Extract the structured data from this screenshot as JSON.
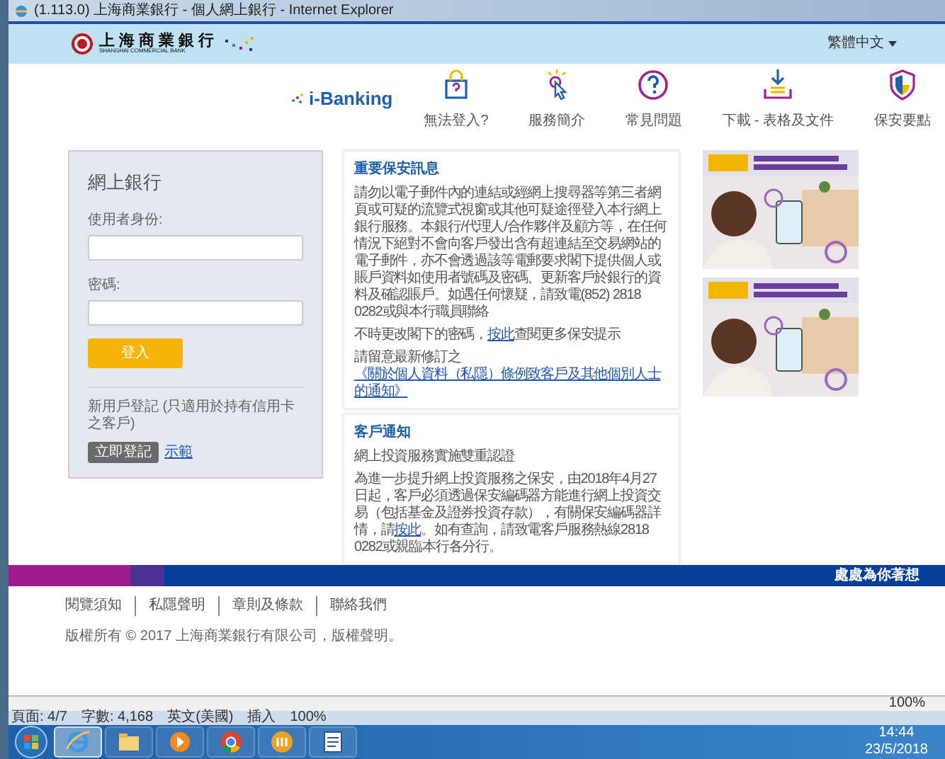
{
  "window": {
    "title": "(1.113.0) 上海商業銀行 - 個人網上銀行 - Internet Explorer"
  },
  "header": {
    "logo_cn": "上海商業銀行",
    "logo_en": "SHANGHAI COMMERCIAL BANK",
    "language": "繁體中文"
  },
  "brand": "i-Banking",
  "quick_links": [
    {
      "kind": "lock",
      "label": "無法登入?"
    },
    {
      "kind": "pointer",
      "label": "服務簡介"
    },
    {
      "kind": "question",
      "label": "常見問題"
    },
    {
      "kind": "download",
      "label": "下載 - 表格及文件"
    },
    {
      "kind": "shield",
      "label": "保安要點"
    }
  ],
  "login": {
    "title": "網上銀行",
    "user_label": "使用者身份:",
    "password_label": "密碼:",
    "login_button": "登入",
    "register_note": "新用戶登記 (只適用於持有信用卡之客戶)",
    "register_button": "立即登記",
    "demo_link": "示範"
  },
  "notices": [
    {
      "title": "重要保安訊息",
      "paragraphs": [
        [
          {
            "text": "請勿以電子郵件內的連結或經網上搜尋器等第三者網頁或可疑的流覽式視窗或其他可疑途徑登入本行網上銀行服務。本銀行/代理人/合作夥伴及顧方等，在任何情況下絕對不會向客戶發出含有超連結至交易網站的電子郵件，亦不會透過該等電郵要求閣下提供個人或賬戶資料如使用者號碼及密碼、更新客戶於銀行的資料及確認賬戶。如遇任何懷疑，請致電(852) 2818 0282或與本行職員聯絡",
            "link": false
          }
        ],
        [
          {
            "text": "不時更改閣下的密碼，",
            "link": false
          },
          {
            "text": "按此",
            "link": true
          },
          {
            "text": "查閱更多保安提示",
            "link": false
          }
        ],
        [
          {
            "text": "請留意最新修訂之",
            "link": false
          },
          {
            "text": "《關於個人資料（私隱）條例致客戶及其他個別人士的通知》",
            "link": true
          }
        ]
      ]
    },
    {
      "title": "客戶通知",
      "paragraphs": [
        [
          {
            "text": "網上投資服務實施雙重認證",
            "link": false
          }
        ],
        [
          {
            "text": "為進一步提升網上投資服務之保安，由2018年4月27日起，客戶必須透過保安編碼器方能進行網上投資交易（包括基金及證券投資存款），有關保安編碼器詳情，請",
            "link": false
          },
          {
            "text": "按此",
            "link": true
          },
          {
            "text": "。如有查詢，請致電客戶服務熱線2818 0282或親臨本行各分行。",
            "link": false
          }
        ]
      ]
    }
  ],
  "ads": [
    {
      "kind": "picture"
    },
    {
      "kind": "picture"
    }
  ],
  "footer": {
    "slogan": "處處為你著想",
    "links": [
      "閱覽須知",
      "私隱聲明",
      "章則及條款",
      "聯絡我們"
    ],
    "copyright": "版權所有 © 2017 上海商業銀行有限公司，版權聲明。"
  },
  "ie_status": {
    "zoom": "100%"
  },
  "word_status": [
    "頁面: 4/7",
    "字數: 4,168",
    "英文(美國)",
    "插入",
    "100%"
  ],
  "taskbar": {
    "apps": [
      {
        "kind": "ie",
        "selected": true
      },
      {
        "kind": "folder",
        "selected": false
      },
      {
        "kind": "media",
        "selected": false
      },
      {
        "kind": "chrome",
        "selected": false
      },
      {
        "kind": "app",
        "selected": false
      },
      {
        "kind": "word",
        "selected": false
      }
    ],
    "time": "14:44",
    "date": "23/5/2018"
  }
}
